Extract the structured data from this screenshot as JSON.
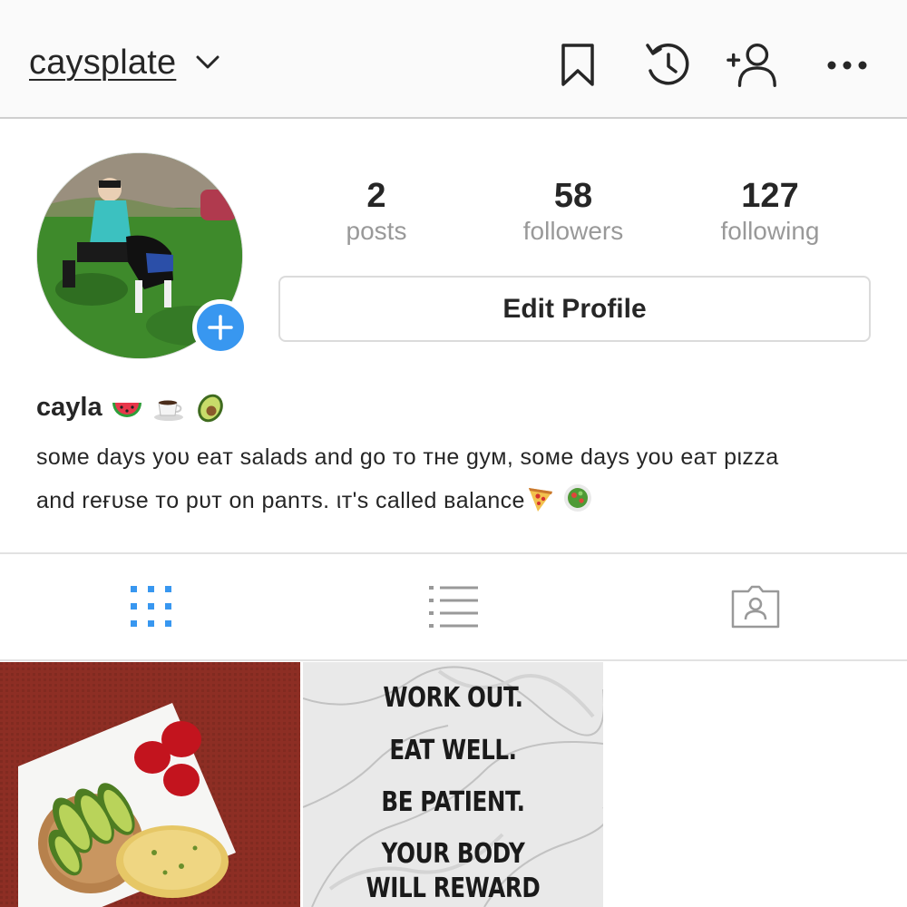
{
  "header": {
    "username": "caysplate",
    "icons": [
      "chevron-down-icon",
      "bookmark-icon",
      "history-icon",
      "add-person-icon",
      "more-icon"
    ]
  },
  "profile": {
    "stats": [
      {
        "num": "2",
        "label": "posts"
      },
      {
        "num": "58",
        "label": "followers"
      },
      {
        "num": "127",
        "label": "following"
      }
    ],
    "edit_label": "Edit Profile",
    "name": "cayla",
    "name_emojis": [
      "watermelon-emoji",
      "coffee-emoji",
      "avocado-emoji"
    ],
    "bio_line1": "ѕoмe dayѕ yoυ eaт ѕaladѕ and go тo тнe gyм, ѕoмe dayѕ yoυ eaт pιzza",
    "bio_line2": "and reғυѕe тo pυт on panтѕ. ιт'ѕ called вalance"
  },
  "tabs": [
    "grid-tab",
    "list-tab",
    "tagged-tab"
  ],
  "posts": [
    {
      "kind": "photo",
      "subject": "avocado toast plate"
    },
    {
      "kind": "quote",
      "lines": [
        "WORK OUT.",
        "EAT WELL.",
        "BE PATIENT.",
        "YOUR BODY",
        "WILL REWARD"
      ]
    }
  ],
  "colors": {
    "accent": "#3897f0",
    "muted": "#999999",
    "text": "#262626"
  }
}
